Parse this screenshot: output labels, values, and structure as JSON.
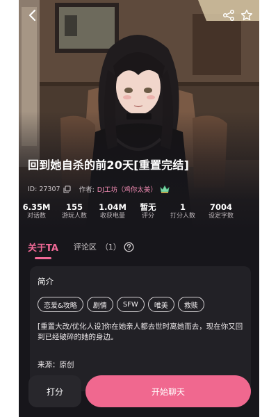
{
  "character": {
    "title": "回到她自杀的前20天[重置完结]",
    "id_text": "ID: 27307",
    "author_label": "作者:",
    "author_name": "DJ工坊（鸡你太美）"
  },
  "stats": [
    {
      "value": "6.35M",
      "label": "对话数"
    },
    {
      "value": "155",
      "label": "游玩人数"
    },
    {
      "value": "1.04M",
      "label": "收获电量"
    },
    {
      "value": "暂无",
      "label": "评分"
    },
    {
      "value": "1",
      "label": "打分人数"
    },
    {
      "value": "7004",
      "label": "设定字数"
    }
  ],
  "tabs": {
    "about": "关于TA",
    "comments": "评论区",
    "comments_count": "（1）"
  },
  "intro": {
    "heading": "简介",
    "tags": [
      "恋爱&攻略",
      "剧情",
      "SFW",
      "唯美",
      "救赎"
    ],
    "description": "[重置大改/优化人设]你在她亲人都去世时离她而去，现在你又回到已经破碎的她的身边。",
    "source": "来源：原创"
  },
  "actions": {
    "rate": "打分",
    "start_chat": "开始聊天"
  },
  "icons": {
    "back": "chevron-left-icon",
    "share": "share-icon",
    "favorite": "star-outline-icon",
    "copy": "copy-icon",
    "author_badge": "crown-badge-icon",
    "help": "question-circle-icon"
  },
  "colors": {
    "accent": "#f36a98",
    "button_primary": "#f0688f",
    "background": "#17161b",
    "card": "#222126"
  }
}
